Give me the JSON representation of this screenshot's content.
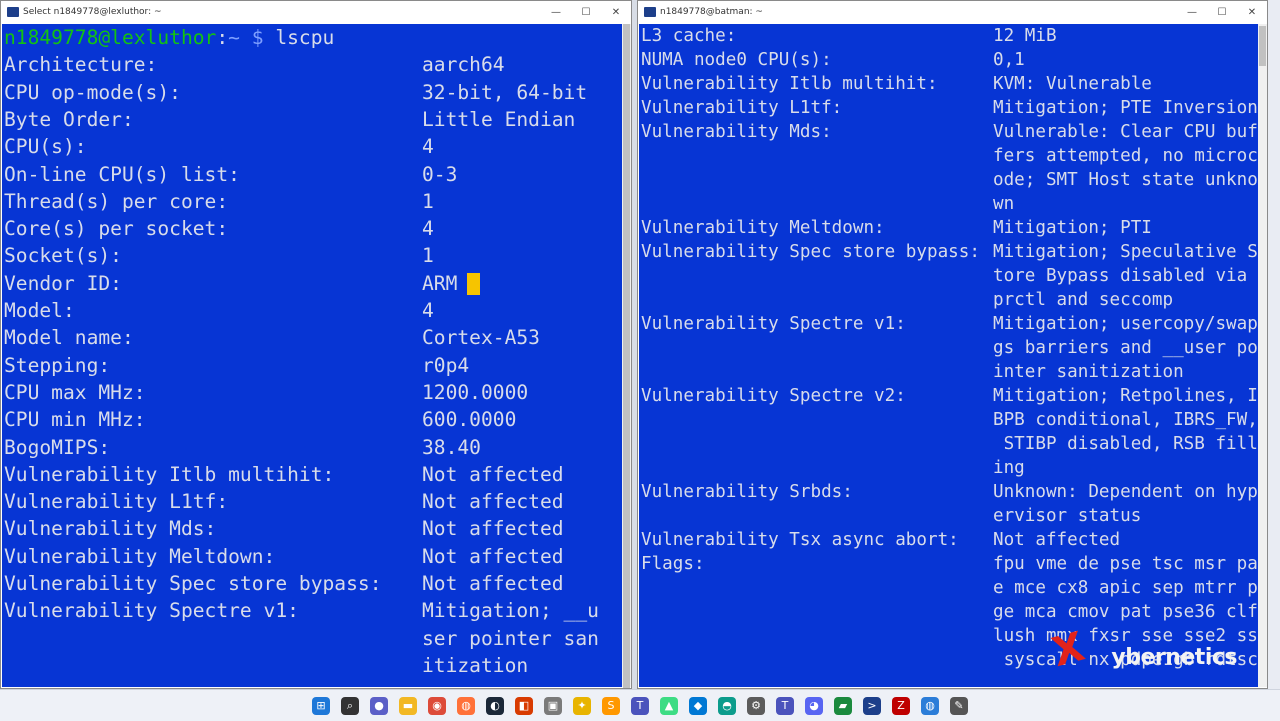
{
  "left_window": {
    "title": "Select n1849778@lexluthor: ~",
    "prompt": {
      "user_host": "n1849778@lexluthor",
      "sep": ":",
      "path": "~",
      "dollar": " $",
      "command": " lscpu"
    },
    "rows": [
      [
        "Architecture:",
        "aarch64"
      ],
      [
        "CPU op-mode(s):",
        "32-bit, 64-bit"
      ],
      [
        "Byte Order:",
        "Little Endian"
      ],
      [
        "CPU(s):",
        "4"
      ],
      [
        "On-line CPU(s) list:",
        "0-3"
      ],
      [
        "Thread(s) per core:",
        "1"
      ],
      [
        "Core(s) per socket:",
        "4"
      ],
      [
        "Socket(s):",
        "1"
      ],
      [
        "Vendor ID:",
        "ARM"
      ],
      [
        "Model:",
        "4"
      ],
      [
        "Model name:",
        "Cortex-A53"
      ],
      [
        "Stepping:",
        "r0p4"
      ],
      [
        "CPU max MHz:",
        "1200.0000"
      ],
      [
        "CPU min MHz:",
        "600.0000"
      ],
      [
        "BogoMIPS:",
        "38.40"
      ],
      [
        "Vulnerability Itlb multihit:",
        "Not affected"
      ],
      [
        "Vulnerability L1tf:",
        "Not affected"
      ],
      [
        "Vulnerability Mds:",
        "Not affected"
      ],
      [
        "Vulnerability Meltdown:",
        "Not affected"
      ],
      [
        "Vulnerability Spec store bypass:",
        "Not affected"
      ],
      [
        "Vulnerability Spectre v1:",
        "Mitigation; __u"
      ],
      [
        "",
        "ser pointer san"
      ],
      [
        "",
        "itization"
      ]
    ]
  },
  "right_window": {
    "title": "n1849778@batman: ~",
    "rows": [
      [
        "L3 cache:",
        "12 MiB"
      ],
      [
        "NUMA node0 CPU(s):",
        "0,1"
      ],
      [
        "Vulnerability Itlb multihit:",
        "KVM: Vulnerable"
      ],
      [
        "Vulnerability L1tf:",
        "Mitigation; PTE Inversion"
      ],
      [
        "Vulnerability Mds:",
        "Vulnerable: Clear CPU buf"
      ],
      [
        "",
        "fers attempted, no microc"
      ],
      [
        "",
        "ode; SMT Host state unkno"
      ],
      [
        "",
        "wn"
      ],
      [
        "Vulnerability Meltdown:",
        "Mitigation; PTI"
      ],
      [
        "Vulnerability Spec store bypass:",
        "Mitigation; Speculative S"
      ],
      [
        "",
        "tore Bypass disabled via"
      ],
      [
        "",
        "prctl and seccomp"
      ],
      [
        "Vulnerability Spectre v1:",
        "Mitigation; usercopy/swap"
      ],
      [
        "",
        "gs barriers and __user po"
      ],
      [
        "",
        "inter sanitization"
      ],
      [
        "Vulnerability Spectre v2:",
        "Mitigation; Retpolines, I"
      ],
      [
        "",
        "BPB conditional, IBRS_FW,"
      ],
      [
        "",
        " STIBP disabled, RSB fill"
      ],
      [
        "",
        "ing"
      ],
      [
        "Vulnerability Srbds:",
        "Unknown: Dependent on hyp"
      ],
      [
        "",
        "ervisor status"
      ],
      [
        "Vulnerability Tsx async abort:",
        "Not affected"
      ],
      [
        "Flags:",
        "fpu vme de pse tsc msr pa"
      ],
      [
        "",
        "e mce cx8 apic sep mtrr p"
      ],
      [
        "",
        "ge mca cmov pat pse36 clf"
      ],
      [
        "",
        "lush mmx fxsr sse sse2 ss"
      ],
      [
        "",
        " syscall nx pdpe1gb rdtsc"
      ]
    ]
  },
  "watermark": {
    "text": "ybernetics",
    "mark": "X"
  },
  "taskbar_icons": [
    {
      "name": "windows-start-icon",
      "color": "#1e78d8",
      "glyph": "⊞"
    },
    {
      "name": "search-icon",
      "color": "#333333",
      "glyph": "⌕"
    },
    {
      "name": "chat-icon",
      "color": "#5b5fc7",
      "glyph": "●"
    },
    {
      "name": "file-explorer-icon",
      "color": "#f2b824",
      "glyph": "▬"
    },
    {
      "name": "chrome-icon",
      "color": "#dd4b39",
      "glyph": "◉"
    },
    {
      "name": "firefox-icon",
      "color": "#ff7139",
      "glyph": "◍"
    },
    {
      "name": "steam-icon",
      "color": "#1b2838",
      "glyph": "◐"
    },
    {
      "name": "office-icon",
      "color": "#d83b01",
      "glyph": "◧"
    },
    {
      "name": "app-icon",
      "color": "#7a7a7a",
      "glyph": "▣"
    },
    {
      "name": "filezilla-folder-icon",
      "color": "#e8b400",
      "glyph": "✦"
    },
    {
      "name": "sublime-icon",
      "color": "#ff9800",
      "glyph": "S"
    },
    {
      "name": "teams-icon",
      "color": "#4b53bc",
      "glyph": "T"
    },
    {
      "name": "android-icon",
      "color": "#3ddc84",
      "glyph": "▲"
    },
    {
      "name": "vscode-icon",
      "color": "#0078d4",
      "glyph": "◆"
    },
    {
      "name": "edge-icon",
      "color": "#0c9c8c",
      "glyph": "◓"
    },
    {
      "name": "gear-icon",
      "color": "#5c5c5c",
      "glyph": "⚙"
    },
    {
      "name": "teams-notify-icon",
      "color": "#4b53bc",
      "glyph": "T"
    },
    {
      "name": "discord-icon",
      "color": "#5865f2",
      "glyph": "◕"
    },
    {
      "name": "terminal-green-icon",
      "color": "#1b8a3e",
      "glyph": "▰"
    },
    {
      "name": "powershell-icon",
      "color": "#1d3f8a",
      "glyph": ">"
    },
    {
      "name": "filezilla-icon",
      "color": "#bf0000",
      "glyph": "Z"
    },
    {
      "name": "globe-icon",
      "color": "#2b7dd8",
      "glyph": "◍"
    },
    {
      "name": "tool-icon",
      "color": "#555555",
      "glyph": "✎"
    }
  ],
  "colors": {
    "terminal_bg": "#0735d4",
    "text": "#d8dcea",
    "user": "#13c213",
    "cursor": "#f6c400"
  }
}
